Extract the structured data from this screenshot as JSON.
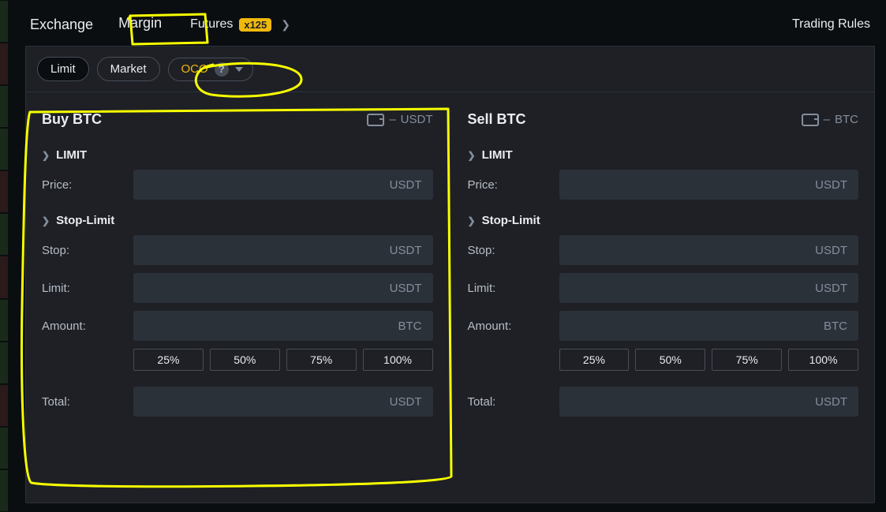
{
  "nav": {
    "exchange": "Exchange",
    "margin": "Margin",
    "futures": "Futures",
    "futures_badge": "x125",
    "trading_rules": "Trading Rules"
  },
  "order_types": {
    "limit": "Limit",
    "market": "Market",
    "oco": "OCO"
  },
  "percent_buttons": [
    "25%",
    "50%",
    "75%",
    "100%"
  ],
  "buy": {
    "title": "Buy BTC",
    "wallet_dash": "–",
    "wallet_unit": "USDT",
    "limit_heading": "LIMIT",
    "stop_limit_heading": "Stop-Limit",
    "labels": {
      "price": "Price:",
      "stop": "Stop:",
      "limit": "Limit:",
      "amount": "Amount:",
      "total": "Total:"
    },
    "units": {
      "price": "USDT",
      "stop": "USDT",
      "limit": "USDT",
      "amount": "BTC",
      "total": "USDT"
    }
  },
  "sell": {
    "title": "Sell BTC",
    "wallet_dash": "–",
    "wallet_unit": "BTC",
    "limit_heading": "LIMIT",
    "stop_limit_heading": "Stop-Limit",
    "labels": {
      "price": "Price:",
      "stop": "Stop:",
      "limit": "Limit:",
      "amount": "Amount:",
      "total": "Total:"
    },
    "units": {
      "price": "USDT",
      "stop": "USDT",
      "limit": "USDT",
      "amount": "BTC",
      "total": "USDT"
    }
  }
}
